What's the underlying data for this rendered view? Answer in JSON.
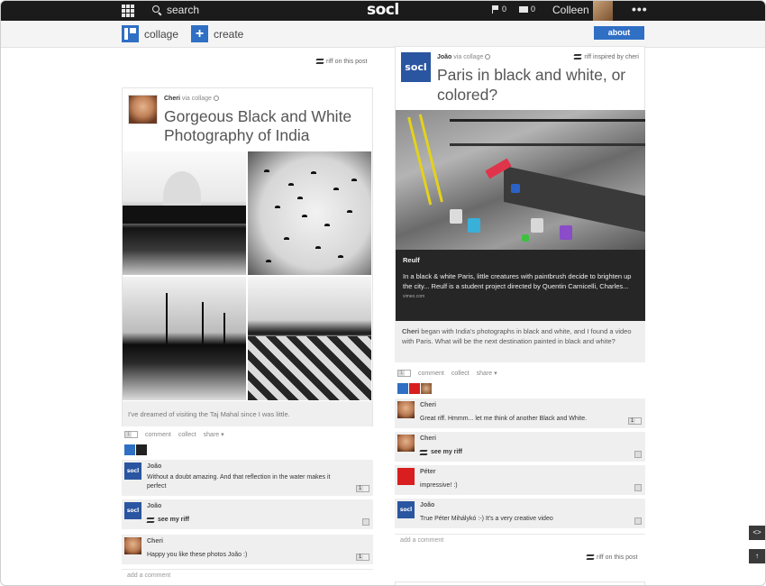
{
  "topbar": {
    "search_label": "search",
    "logo": "socl",
    "flag_count": "0",
    "mail_count": "0",
    "user_name": "Colleen",
    "more": "•••"
  },
  "actionbar": {
    "collage_label": "collage",
    "create_label": "create",
    "about_label": "about"
  },
  "left_top_riff": "riff on this post",
  "post1": {
    "author": "Cheri",
    "via": "via collage",
    "title": "Gorgeous Black and White Photography of India",
    "caption": "I've dreamed of visiting the Taj Mahal since I was little.",
    "actions": {
      "comment": "comment",
      "collect": "collect",
      "share": "share ▾",
      "count": "1"
    },
    "comments": [
      {
        "name": "João",
        "text": "Without a doubt amazing. And that reflection in the water makes it perfect",
        "count": "1"
      },
      {
        "name": "João",
        "text": "see my riff"
      },
      {
        "name": "Cheri",
        "text": "Happy you like these photos João :)",
        "count": "1"
      }
    ],
    "add_comment": "add a comment"
  },
  "post2": {
    "author": "João",
    "via": "via collage",
    "inspired": "riff inspired by cheri",
    "title": "Paris in black and white, or colored?",
    "video_title": "Reulf",
    "video_body": "In a black & white Paris, little creatures with paintbrush decide to brighten up the city... Reulf is a student project directed by Quentin Carnicelli, Charles...",
    "video_source": "vimeo.com",
    "desc_author": "Cheri",
    "desc_text": "began with India's photographs in black and white, and I found a video with Paris. What will be the next destination painted in black and white?",
    "actions": {
      "comment": "comment",
      "collect": "collect",
      "share": "share ▾",
      "count": "1"
    },
    "comments": [
      {
        "name": "Cheri",
        "text": "Great riff. Hmmm... let me think of another Black and White.",
        "count": "1"
      },
      {
        "name": "Cheri",
        "text": "see my riff"
      },
      {
        "name": "Péter",
        "text": "impressive! :)"
      },
      {
        "name": "João",
        "text_bold": "Péter Mihálykó",
        "text": "True Péter Mihálykó :-) It's a very creative video"
      }
    ],
    "add_comment": "add a comment",
    "riff_label": "riff on this post"
  },
  "colors": {
    "accent": "#2f6fc4",
    "topbar": "#1b1b1b"
  }
}
